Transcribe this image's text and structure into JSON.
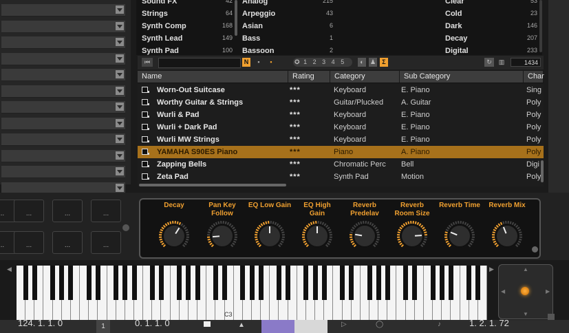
{
  "filters": {
    "col1": [
      {
        "label": "Sound FX",
        "count": "42"
      },
      {
        "label": "Strings",
        "count": "64"
      },
      {
        "label": "Synth Comp",
        "count": "168"
      },
      {
        "label": "Synth Lead",
        "count": "149"
      },
      {
        "label": "Synth Pad",
        "count": "100"
      }
    ],
    "col2": [
      {
        "label": "Analog",
        "count": "215"
      },
      {
        "label": "Arpeggio",
        "count": "43"
      },
      {
        "label": "Asian",
        "count": "6"
      },
      {
        "label": "Bass",
        "count": "1"
      },
      {
        "label": "Bassoon",
        "count": "2"
      }
    ],
    "col3": [
      {
        "label": "Clear",
        "count": "53"
      },
      {
        "label": "Cold",
        "count": "23"
      },
      {
        "label": "Dark",
        "count": "146"
      },
      {
        "label": "Decay",
        "count": "207"
      },
      {
        "label": "Digital",
        "count": "233"
      }
    ]
  },
  "toolbar": {
    "n_button": "N",
    "rating_1": "1",
    "rating_2": "2",
    "rating_3": "3",
    "rating_4": "4",
    "rating_5": "5",
    "sigma_button": "Σ",
    "result_count": "1434"
  },
  "table": {
    "headers": [
      "Name",
      "Rating",
      "Category",
      "Sub Category",
      "Char"
    ],
    "rows": [
      {
        "name": "Worn-Out Suitcase",
        "rating": "***",
        "category": "Keyboard",
        "sub": "E. Piano",
        "char": "Sing"
      },
      {
        "name": "Worthy Guitar & Strings",
        "rating": "***",
        "category": "Guitar/Plucked",
        "sub": "A. Guitar",
        "char": "Poly"
      },
      {
        "name": "Wurli & Pad",
        "rating": "***",
        "category": "Keyboard",
        "sub": "E. Piano",
        "char": "Poly"
      },
      {
        "name": "Wurli + Dark Pad",
        "rating": "***",
        "category": "Keyboard",
        "sub": "E. Piano",
        "char": "Poly"
      },
      {
        "name": "Wurli MW Strings",
        "rating": "***",
        "category": "Keyboard",
        "sub": "E. Piano",
        "char": "Poly"
      },
      {
        "name": "YAMAHA S90ES Piano",
        "rating": "***",
        "category": "Piano",
        "sub": "A. Piano",
        "char": "Poly",
        "selected": true
      },
      {
        "name": "Zapping Bells",
        "rating": "***",
        "category": "Chromatic Perc",
        "sub": "Bell",
        "char": "Digi"
      },
      {
        "name": "Zeta Pad",
        "rating": "***",
        "category": "Synth Pad",
        "sub": "Motion",
        "char": "Poly"
      }
    ]
  },
  "pads": {
    "label": "..."
  },
  "knobs": [
    {
      "label": "Decay",
      "value": 0.62
    },
    {
      "label": "Pan Key\nFollow",
      "value": 0.15
    },
    {
      "label": "EQ Low Gain",
      "value": 0.5
    },
    {
      "label": "EQ High\nGain",
      "value": 0.5
    },
    {
      "label": "Reverb\nPredelav",
      "value": 0.2
    },
    {
      "label": "Reverb\nRoom Size",
      "value": 0.82
    },
    {
      "label": "Reverb Time",
      "value": 0.25
    },
    {
      "label": "Reverb Mix",
      "value": 0.42
    }
  ],
  "keyboard": {
    "c3_label": "C3"
  },
  "bottombar": {
    "pos1": "124. 1. 1. 0",
    "pos2": "1",
    "pos3": "0. 1. 1. 0",
    "pos4": "1. 2. 1. 72"
  },
  "colors": {
    "accent": "#f0a030",
    "selected_row": "#a7711b"
  }
}
